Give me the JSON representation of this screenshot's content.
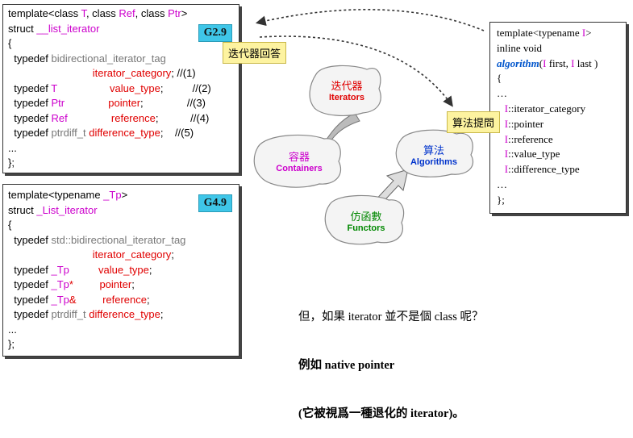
{
  "top_box": {
    "badge": "G2.9",
    "lines": [
      [
        [
          "template<class ",
          "kw"
        ],
        [
          "T",
          "mag"
        ],
        [
          ", class ",
          "kw"
        ],
        [
          "Ref",
          "mag"
        ],
        [
          ", class ",
          "kw"
        ],
        [
          "Ptr",
          "mag"
        ],
        [
          ">",
          "kw"
        ]
      ],
      [
        [
          "struct ",
          "kw"
        ],
        [
          "__list_iterator",
          "mag"
        ]
      ],
      [
        [
          "{",
          "kw"
        ]
      ],
      [
        [
          "  typedef ",
          "kw"
        ],
        [
          "bidirectional_iterator_tag",
          "gray"
        ]
      ],
      [
        [
          "                             iterator_category",
          "red"
        ],
        [
          "; //(1)",
          "kw"
        ]
      ],
      [
        [
          "  typedef ",
          "kw"
        ],
        [
          "T",
          "mag"
        ],
        [
          "                  value_type",
          "red"
        ],
        [
          ";          //(2)",
          "kw"
        ]
      ],
      [
        [
          "  typedef ",
          "kw"
        ],
        [
          "Ptr",
          "mag"
        ],
        [
          "               pointer",
          "red"
        ],
        [
          ";               //(3)",
          "kw"
        ]
      ],
      [
        [
          "  typedef ",
          "kw"
        ],
        [
          "Ref",
          "mag"
        ],
        [
          "               reference",
          "red"
        ],
        [
          ";           //(4)",
          "kw"
        ]
      ],
      [
        [
          "  typedef ",
          "kw"
        ],
        [
          "ptrdiff_t",
          "gray"
        ],
        [
          " difference_type",
          "red"
        ],
        [
          ";    //(5)",
          "kw"
        ]
      ],
      [
        [
          "...",
          "kw"
        ]
      ],
      [
        [
          "};",
          "kw"
        ]
      ]
    ]
  },
  "bottom_box": {
    "badge": "G4.9",
    "lines": [
      [
        [
          "template<typename ",
          "kw"
        ],
        [
          "_Tp",
          "mag"
        ],
        [
          ">",
          "kw"
        ]
      ],
      [
        [
          "struct ",
          "kw"
        ],
        [
          "_List_iterator",
          "mag"
        ]
      ],
      [
        [
          "{",
          "kw"
        ]
      ],
      [
        [
          "  typedef ",
          "kw"
        ],
        [
          "std::bidirectional_iterator_tag",
          "gray"
        ]
      ],
      [
        [
          "                             iterator_category",
          "red"
        ],
        [
          ";",
          "kw"
        ]
      ],
      [
        [
          "  typedef ",
          "kw"
        ],
        [
          "_Tp",
          "mag"
        ],
        [
          "          value_type",
          "red"
        ],
        [
          ";",
          "kw"
        ]
      ],
      [
        [
          "  typedef ",
          "kw"
        ],
        [
          "_Tp",
          "mag"
        ],
        [
          "*         pointer",
          "red"
        ],
        [
          ";",
          "kw"
        ]
      ],
      [
        [
          "  typedef ",
          "kw"
        ],
        [
          "_Tp",
          "mag"
        ],
        [
          "&         reference",
          "red"
        ],
        [
          ";",
          "kw"
        ]
      ],
      [
        [
          "  typedef ",
          "kw"
        ],
        [
          "ptrdiff_t",
          "gray"
        ],
        [
          " difference_type",
          "red"
        ],
        [
          ";",
          "kw"
        ]
      ],
      [
        [
          "...",
          "kw"
        ]
      ],
      [
        [
          "};",
          "kw"
        ]
      ]
    ]
  },
  "right_box": {
    "lines": [
      [
        [
          "template<typename ",
          "kw"
        ],
        [
          "I",
          "mag"
        ],
        [
          ">",
          "kw"
        ]
      ],
      [
        [
          "inline void",
          "kw"
        ]
      ],
      [
        [
          "algorithm",
          "algo"
        ],
        [
          "(",
          "kw"
        ],
        [
          "I",
          "mag"
        ],
        [
          " first, ",
          "kw"
        ],
        [
          "I",
          "mag"
        ],
        [
          " last )",
          "kw"
        ]
      ],
      [
        [
          "{",
          "kw"
        ]
      ],
      [
        [
          "…",
          "kw"
        ]
      ],
      [
        [
          "   I",
          "mag"
        ],
        [
          "::iterator_category",
          "kw"
        ]
      ],
      [
        [
          "   I",
          "mag"
        ],
        [
          "::pointer",
          "kw"
        ]
      ],
      [
        [
          "   I",
          "mag"
        ],
        [
          "::reference",
          "kw"
        ]
      ],
      [
        [
          "   I",
          "mag"
        ],
        [
          "::value_type",
          "kw"
        ]
      ],
      [
        [
          "   I",
          "mag"
        ],
        [
          "::difference_type",
          "kw"
        ]
      ],
      [
        [
          "…",
          "kw"
        ]
      ],
      [
        [
          "};",
          "kw"
        ]
      ]
    ]
  },
  "callouts": {
    "iterator_answer": "迭代器回答",
    "algorithm_ask": "算法提問"
  },
  "blobs": {
    "iterators": {
      "zh": "迭代器",
      "en": "Iterators"
    },
    "containers": {
      "zh": "容器",
      "en": "Containers"
    },
    "algorithms": {
      "zh": "算法",
      "en": "Algorithms"
    },
    "functors": {
      "zh": "仿函數",
      "en": "Functors"
    }
  },
  "note": {
    "line1": "但，如果 iterator 並不是個 class 呢？",
    "line2": "例如 native pointer",
    "line3": "(它被視爲一種退化的 iterator)。"
  },
  "colors": {
    "magenta": "#cc00cc",
    "red": "#e00000",
    "badge": "#3fc6e8",
    "callout": "#fdf3a0",
    "iterators": "#e00000",
    "containers": "#cc00cc",
    "algorithms": "#0033cc",
    "functors": "#008800"
  }
}
